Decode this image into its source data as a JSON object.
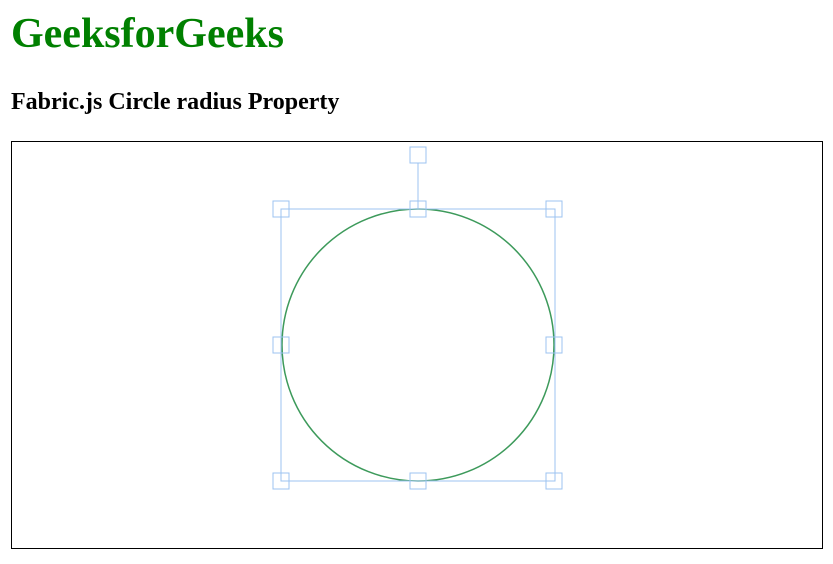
{
  "header": {
    "brand": "GeeksforGeeks",
    "subtitle": "Fabric.js Circle radius Property"
  },
  "canvas": {
    "object": {
      "type": "circle",
      "stroke_color": "#3d9a5b",
      "selected": true,
      "selection_color": "#9cc3f0",
      "controls": [
        "tl",
        "mt",
        "tr",
        "ml",
        "mr",
        "bl",
        "mb",
        "br",
        "mtr"
      ]
    }
  },
  "colors": {
    "brand": "#008000",
    "canvas_border": "#000000"
  }
}
